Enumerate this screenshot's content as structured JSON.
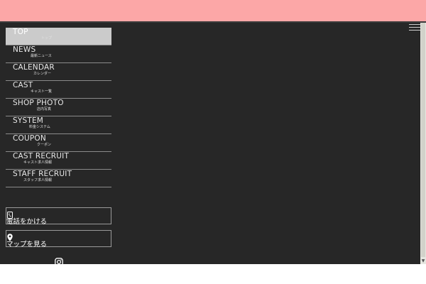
{
  "nav": {
    "items": [
      {
        "en": "TOP",
        "ja": "トップ"
      },
      {
        "en": "NEWS",
        "ja": "最新ニュース"
      },
      {
        "en": "CALENDAR",
        "ja": "カレンダー"
      },
      {
        "en": "CAST",
        "ja": "キャスト一覧"
      },
      {
        "en": "SHOP PHOTO",
        "ja": "店内写真"
      },
      {
        "en": "SYSTEM",
        "ja": "料金システム"
      },
      {
        "en": "COUPON",
        "ja": "クーポン"
      },
      {
        "en": "CAST RECRUIT",
        "ja": "キャスト求人情報"
      },
      {
        "en": "STAFF RECRUIT",
        "ja": "スタッフ求人情報"
      }
    ],
    "active_index": 0
  },
  "actions": {
    "phone_label": "電話をかける",
    "map_label": "マップを見る"
  },
  "icons": {
    "phone": "phone-icon",
    "map": "map-pin-icon",
    "instagram": "instagram-icon",
    "menu": "hamburger-menu-icon"
  },
  "colors": {
    "header": "#fca7a7",
    "background": "#272727",
    "active_item": "#cbcbcb"
  }
}
